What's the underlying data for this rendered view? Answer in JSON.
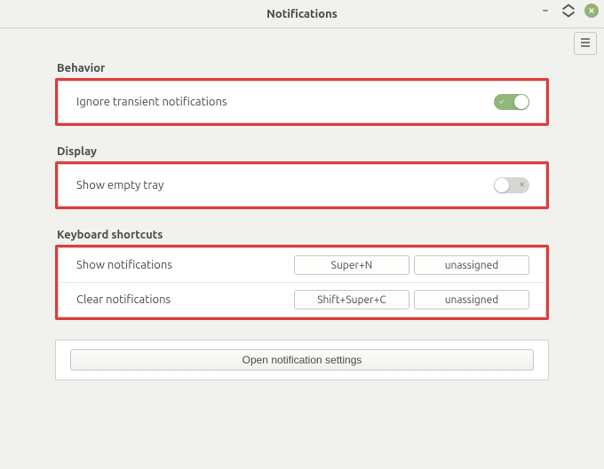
{
  "window": {
    "title": "Notifications"
  },
  "sections": {
    "behavior": {
      "heading": "Behavior",
      "items": {
        "ignore_transient": {
          "label": "Ignore transient notifications",
          "enabled": true
        }
      }
    },
    "display": {
      "heading": "Display",
      "items": {
        "show_empty_tray": {
          "label": "Show empty tray",
          "enabled": false
        }
      }
    },
    "keyboard": {
      "heading": "Keyboard shortcuts",
      "items": [
        {
          "label": "Show notifications",
          "shortcut1": "Super+N",
          "shortcut2": "unassigned"
        },
        {
          "label": "Clear notifications",
          "shortcut1": "Shift+Super+C",
          "shortcut2": "unassigned"
        }
      ]
    }
  },
  "buttons": {
    "open_settings": "Open notification settings"
  },
  "toggle_glyphs": {
    "on": "✓",
    "off": "✕"
  }
}
